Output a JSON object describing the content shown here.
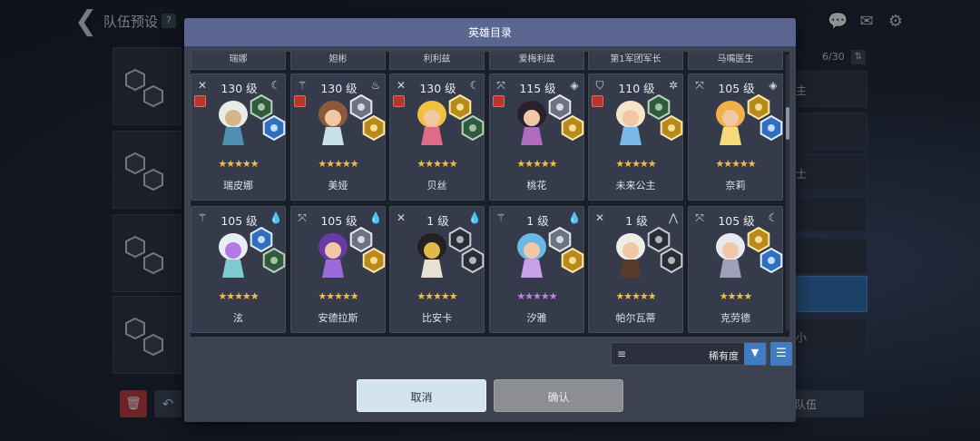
{
  "background": {
    "title": "队伍预设",
    "help": "?",
    "count": "6/30",
    "right_items": [
      "主",
      "",
      "士",
      "",
      "",
      "",
      "小"
    ],
    "team_button": "队伍"
  },
  "modal": {
    "title": "英雄目录",
    "partial_names": [
      "瑞娜",
      "妲彬",
      "利利兹",
      "爱梅利兹",
      "第1军团军长",
      "马嘴医生"
    ],
    "heroes": [
      {
        "level": "130 级",
        "name": "瑞皮娜",
        "stars": "★★★★★",
        "star_color": "gold",
        "class_icon": "sword-icon",
        "element_icon": "moon-icon",
        "red_icon": true,
        "badges": [
          "green",
          "blue"
        ],
        "sprite_colors": [
          "#e9ece6",
          "#4f8fb0",
          "#d7b58a"
        ]
      },
      {
        "level": "130 级",
        "name": "美娅",
        "stars": "★★★★★",
        "star_color": "gold",
        "class_icon": "staff-icon",
        "element_icon": "fire-icon",
        "red_icon": true,
        "badges": [
          "silver",
          "gold"
        ],
        "sprite_colors": [
          "#8b5a3a",
          "#c7dfe9",
          "#f2c7a5"
        ]
      },
      {
        "level": "130 级",
        "name": "贝丝",
        "stars": "★★★★★",
        "star_color": "gold",
        "class_icon": "sword-icon",
        "element_icon": "moon-icon",
        "red_icon": true,
        "badges": [
          "gold",
          "green"
        ],
        "sprite_colors": [
          "#f0c040",
          "#e06a8a",
          "#f2c7a5"
        ]
      },
      {
        "level": "115 级",
        "name": "桃花",
        "stars": "★★★★★",
        "star_color": "gold",
        "class_icon": "bow-icon",
        "element_icon": "diamond-icon",
        "red_icon": true,
        "badges": [
          "silver",
          "gold"
        ],
        "sprite_colors": [
          "#2a2030",
          "#b06ac0",
          "#f2c7a5"
        ]
      },
      {
        "level": "110 级",
        "name": "未来公主",
        "stars": "★★★★★",
        "star_color": "gold",
        "class_icon": "shield-icon",
        "element_icon": "gear-icon",
        "red_icon": true,
        "badges": [
          "green",
          "gold"
        ],
        "sprite_colors": [
          "#f5e6c8",
          "#7ab8e8",
          "#f2c7a5"
        ]
      },
      {
        "level": "105 级",
        "name": "奈莉",
        "stars": "★★★★★",
        "star_color": "gold",
        "class_icon": "bow-icon",
        "element_icon": "diamond-icon",
        "red_icon": false,
        "badges": [
          "gold",
          "blue"
        ],
        "sprite_colors": [
          "#f2b04a",
          "#f7d97a",
          "#f2c7a5"
        ]
      },
      {
        "level": "105 级",
        "name": "泫",
        "stars": "★★★★★",
        "star_color": "gold",
        "class_icon": "staff-icon",
        "element_icon": "water-icon",
        "red_icon": false,
        "badges": [
          "blue",
          "green"
        ],
        "sprite_colors": [
          "#e8eef5",
          "#7ecbd0",
          "#b47ae0"
        ]
      },
      {
        "level": "105 级",
        "name": "安德拉斯",
        "stars": "★★★★★",
        "star_color": "gold",
        "class_icon": "bow-icon",
        "element_icon": "water-icon",
        "red_icon": false,
        "badges": [
          "silver",
          "gold"
        ],
        "sprite_colors": [
          "#6a3aa8",
          "#9a6ad8",
          "#f2c7a5"
        ]
      },
      {
        "level": "1 级",
        "name": "比安卡",
        "stars": "★★★★★",
        "star_color": "gold",
        "class_icon": "sword-icon",
        "element_icon": "water-icon",
        "red_icon": false,
        "badges": [
          "dark",
          "dark"
        ],
        "sprite_colors": [
          "#222222",
          "#e8e0d0",
          "#e2b84a"
        ]
      },
      {
        "level": "1 级",
        "name": "汐雅",
        "stars": "★★★★★",
        "star_color": "purple",
        "class_icon": "staff-icon",
        "element_icon": "water-icon",
        "red_icon": false,
        "badges": [
          "silver",
          "gold"
        ],
        "sprite_colors": [
          "#6ab8e8",
          "#c9a0e8",
          "#f2c7a5"
        ]
      },
      {
        "level": "1 级",
        "name": "帕尔瓦蒂",
        "stars": "★★★★★",
        "star_color": "gold",
        "class_icon": "sword-icon",
        "element_icon": "mountain-icon",
        "red_icon": false,
        "badges": [
          "dark",
          "dark"
        ],
        "sprite_colors": [
          "#f0ece6",
          "#5a3a2a",
          "#f2c7a5"
        ]
      },
      {
        "level": "105 级",
        "name": "克劳德",
        "stars": "★★★★",
        "star_color": "gold",
        "class_icon": "bow-icon",
        "element_icon": "moon-icon",
        "red_icon": false,
        "badges": [
          "gold",
          "blue"
        ],
        "sprite_colors": [
          "#e8e8f0",
          "#a0a0b8",
          "#f2c7a5"
        ]
      }
    ],
    "sort": {
      "label": "稀有度"
    },
    "cancel_label": "取消",
    "confirm_label": "确认"
  },
  "colors": {
    "header": "#5a6590",
    "accent_blue": "#3f7cc4",
    "star_gold": "#f0c238",
    "star_purple": "#c77ee6"
  }
}
